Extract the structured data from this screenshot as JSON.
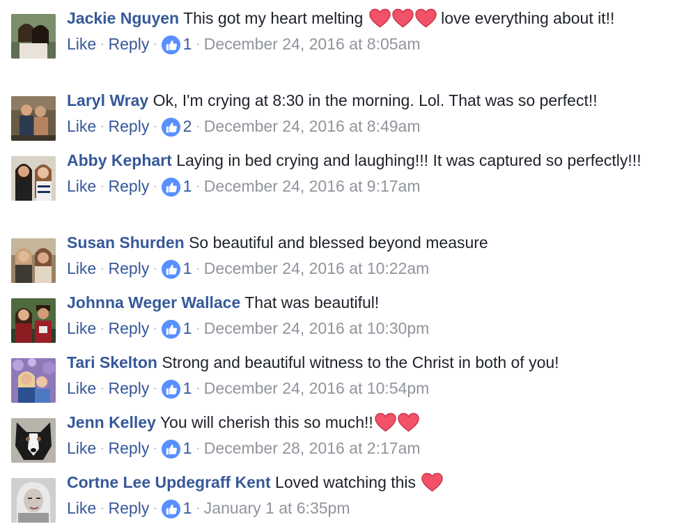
{
  "colors": {
    "author_link": "#365899",
    "meta_text": "#90949c",
    "like_badge": "#5890ff",
    "heart": "#f25268"
  },
  "icons": {
    "heart": "heart-emoji-icon",
    "like": "thumbs-up-icon"
  },
  "actions": {
    "like_label": "Like",
    "reply_label": "Reply",
    "separator": "·"
  },
  "comments": [
    {
      "author": "Jackie Nguyen",
      "text_before": "This got my heart melting",
      "hearts": 3,
      "text_after": "love everything about it!!",
      "likes": "1",
      "timestamp": "December 24, 2016 at 8:05am"
    },
    {
      "author": "Laryl Wray",
      "text_before": "Ok, I'm crying at 8:30 in the morning. Lol. That was so perfect!!",
      "hearts": 0,
      "text_after": "",
      "likes": "2",
      "timestamp": "December 24, 2016 at 8:49am"
    },
    {
      "author": "Abby Kephart",
      "text_before": "Laying in bed crying and laughing!!! It was captured so perfectly!!!",
      "hearts": 0,
      "text_after": "",
      "likes": "1",
      "timestamp": "December 24, 2016 at 9:17am"
    },
    {
      "author": "Susan Shurden",
      "text_before": "So beautiful and blessed beyond measure",
      "hearts": 0,
      "text_after": "",
      "likes": "1",
      "timestamp": "December 24, 2016 at 10:22am"
    },
    {
      "author": "Johnna Weger Wallace",
      "text_before": "That was beautiful!",
      "hearts": 0,
      "text_after": "",
      "likes": "1",
      "timestamp": "December 24, 2016 at 10:30pm"
    },
    {
      "author": "Tari Skelton",
      "text_before": "Strong and beautiful witness to the Christ in both of you!",
      "hearts": 0,
      "text_after": "",
      "likes": "1",
      "timestamp": "December 24, 2016 at 10:54pm"
    },
    {
      "author": "Jenn Kelley",
      "text_before": "You will cherish this so much!!",
      "hearts": 2,
      "text_after": "",
      "likes": "1",
      "timestamp": "December 28, 2016 at 2:17am"
    },
    {
      "author": "Cortne Lee Updegraff Kent",
      "text_before": "Loved watching this",
      "hearts": 1,
      "text_after": "",
      "likes": "1",
      "timestamp": "January 1 at 6:35pm"
    }
  ]
}
